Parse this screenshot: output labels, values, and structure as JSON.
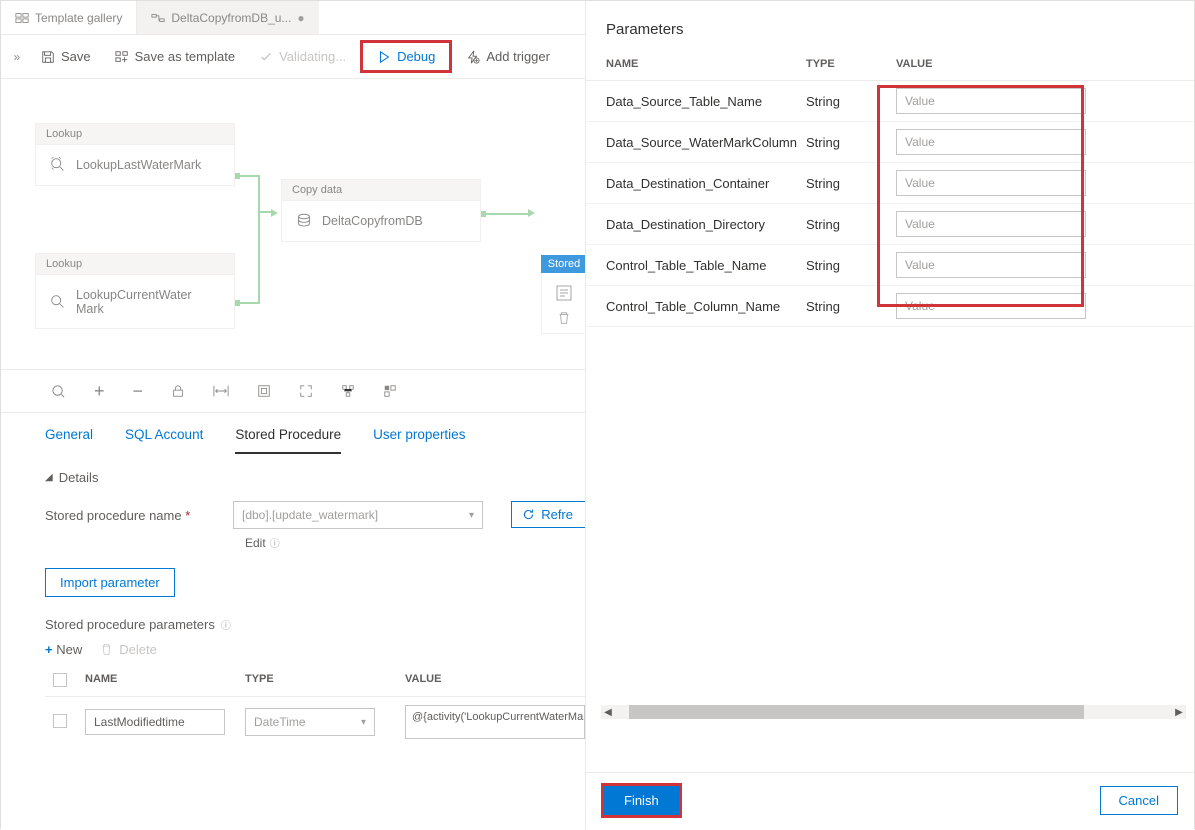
{
  "tabs": {
    "template_gallery": "Template gallery",
    "current": "DeltaCopyfromDB_u..."
  },
  "toolbar": {
    "save": "Save",
    "save_as_template": "Save as template",
    "validating": "Validating...",
    "debug": "Debug",
    "add_trigger": "Add trigger"
  },
  "canvas": {
    "lookup_label": "Lookup",
    "lookup_last": "LookupLastWaterMark",
    "lookup_current": "LookupCurrentWater\nMark",
    "copy_data_label": "Copy data",
    "copy_data": "DeltaCopyfromDB",
    "stored_label": "Stored"
  },
  "detail_tabs": {
    "general": "General",
    "sql_account": "SQL Account",
    "stored_procedure": "Stored Procedure",
    "user_properties": "User properties"
  },
  "details": {
    "header": "Details",
    "sp_name_label": "Stored procedure name",
    "sp_name_value": "[dbo].[update_watermark]",
    "edit": "Edit",
    "import_parameter": "Import parameter",
    "refresh": "Refresh",
    "spp_header": "Stored procedure parameters",
    "new": "New",
    "delete": "Delete",
    "grid": {
      "name_h": "NAME",
      "type_h": "TYPE",
      "value_h": "VALUE",
      "row_name": "LastModifiedtime",
      "row_type": "DateTime",
      "row_value": "@{activity('LookupCurrentWaterMark').output.firstRow.NewWatermarkValue}"
    }
  },
  "panel": {
    "title": "Parameters",
    "headers": {
      "name": "NAME",
      "type": "TYPE",
      "value": "VALUE"
    },
    "placeholder": "Value",
    "rows": [
      {
        "name": "Data_Source_Table_Name",
        "type": "String"
      },
      {
        "name": "Data_Source_WaterMarkColumn",
        "type": "String"
      },
      {
        "name": "Data_Destination_Container",
        "type": "String"
      },
      {
        "name": "Data_Destination_Directory",
        "type": "String"
      },
      {
        "name": "Control_Table_Table_Name",
        "type": "String"
      },
      {
        "name": "Control_Table_Column_Name",
        "type": "String"
      }
    ],
    "finish": "Finish",
    "cancel": "Cancel"
  }
}
